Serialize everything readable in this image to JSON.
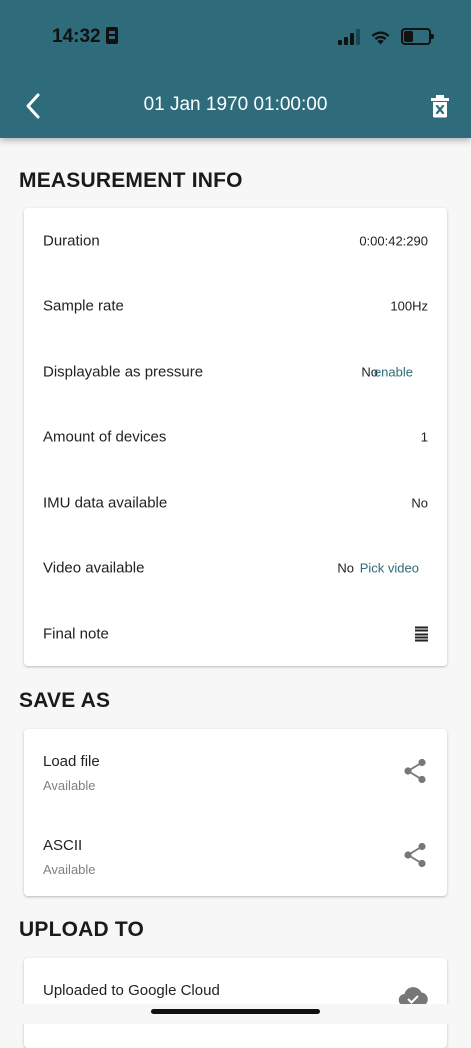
{
  "status_bar": {
    "time": "14:32"
  },
  "app_bar": {
    "title": "01 Jan 1970 01:00:00"
  },
  "measurement_info": {
    "heading": "MEASUREMENT INFO",
    "duration_label": "Duration",
    "duration_value": "0:00:42:290",
    "sample_rate_label": "Sample rate",
    "sample_rate_value": "100Hz",
    "pressure_label": "Displayable as pressure",
    "pressure_value": "No",
    "pressure_action": "enable",
    "devices_label": "Amount of devices",
    "devices_value": "1",
    "imu_label": "IMU data available",
    "imu_value": "No",
    "video_label": "Video available",
    "video_value": "No",
    "video_action": "Pick video",
    "note_label": "Final note"
  },
  "save_as": {
    "heading": "SAVE AS",
    "items": [
      {
        "title": "Load file",
        "status": "Available"
      },
      {
        "title": "ASCII",
        "status": "Available"
      }
    ]
  },
  "upload_to": {
    "heading": "UPLOAD TO",
    "item_title": "Uploaded to Google Cloud"
  },
  "colors": {
    "app_bar": "#2e6b7b",
    "accent": "#2e6b7b",
    "background": "#f7f7f7"
  }
}
